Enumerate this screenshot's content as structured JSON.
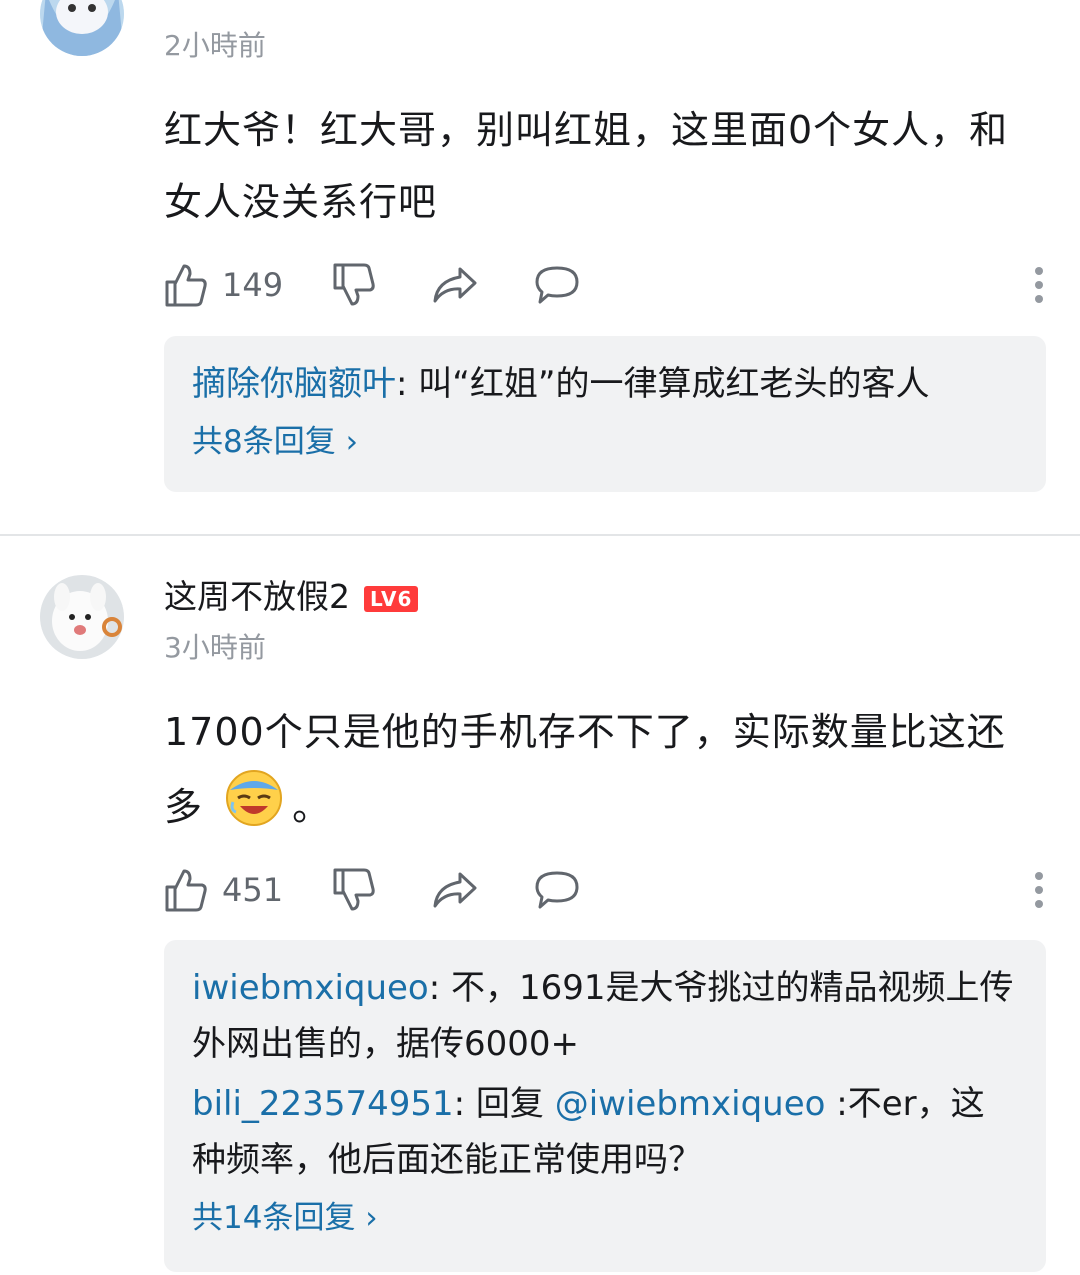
{
  "comments": [
    {
      "username": "",
      "time": "2小時前",
      "text": "红大爷！红大哥，别叫红姐，这里面0个女人，和女人没关系行吧",
      "likes": "149",
      "replies": [
        {
          "name": "摘除你脑额叶",
          "sep": ":",
          "text": " 叫“红姐”的一律算成红老头的客人"
        }
      ],
      "total_replies": "共8条回复 ›"
    },
    {
      "username": "这周不放假2",
      "level": "LV6",
      "time": "3小時前",
      "text": "1700个只是他的手机存不下了，实际数量比这还多",
      "text_end": "。",
      "likes": "451",
      "replies": [
        {
          "name": "iwiebmxiqueo",
          "sep": ":",
          "text": " 不，1691是大爷挑过的精品视频上传外网出售的，据传6000+"
        },
        {
          "name": "bili_223574951",
          "sep": ":",
          "pre": " 回复 ",
          "mention": "@iwiebmxiqueo",
          "text": " :不er，这种频率，他后面还能正常使用吗？"
        }
      ],
      "total_replies": "共14条回复 ›"
    }
  ],
  "colors": {
    "link": "#1a6fa8",
    "level_badge": "#ff3b3b",
    "muted": "#9499a0"
  },
  "icons": [
    "like-icon",
    "dislike-icon",
    "share-icon",
    "comment-icon",
    "more-icon",
    "emoji-icon"
  ]
}
